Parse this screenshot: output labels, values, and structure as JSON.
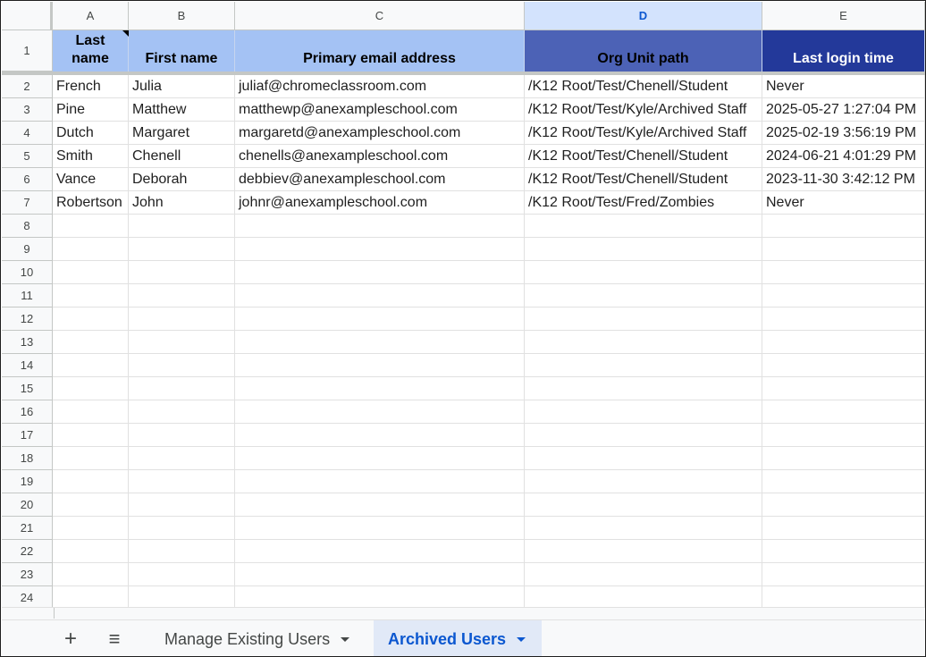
{
  "columns": [
    "A",
    "B",
    "C",
    "D",
    "E"
  ],
  "selected_column": "D",
  "rows": [
    "1",
    "2",
    "3",
    "4",
    "5",
    "6",
    "7",
    "8",
    "9",
    "10",
    "11",
    "12",
    "13",
    "14",
    "15",
    "16",
    "17",
    "18",
    "19",
    "20",
    "21",
    "22",
    "23",
    "24"
  ],
  "header_cells": [
    {
      "text": "Last\nname",
      "bg": "#a4c2f4",
      "fg": "#000000"
    },
    {
      "text": "First name",
      "bg": "#a4c2f4",
      "fg": "#000000"
    },
    {
      "text": "Primary email address",
      "bg": "#a4c2f4",
      "fg": "#000000"
    },
    {
      "text": "Org Unit path",
      "bg": "#4c62b6",
      "fg": "#000000"
    },
    {
      "text": "Last login time",
      "bg": "#23399a",
      "fg": "#ffffff"
    }
  ],
  "data": [
    [
      "French",
      "Julia",
      "juliaf@chromeclassroom.com",
      "/K12 Root/Test/Chenell/Student",
      "Never"
    ],
    [
      "Pine",
      "Matthew",
      "matthewp@anexampleschool.com",
      "/K12 Root/Test/Kyle/Archived Staff",
      "2025-05-27 1:27:04 PM"
    ],
    [
      "Dutch",
      "Margaret",
      "margaretd@anexampleschool.com",
      "/K12 Root/Test/Kyle/Archived Staff",
      "2025-02-19 3:56:19 PM"
    ],
    [
      "Smith",
      "Chenell",
      "chenells@anexampleschool.com",
      "/K12 Root/Test/Chenell/Student",
      "2024-06-21 4:01:29 PM"
    ],
    [
      "Vance",
      "Deborah",
      "debbiev@anexampleschool.com",
      "/K12 Root/Test/Chenell/Student",
      "2023-11-30 3:42:12 PM"
    ],
    [
      "Robertson",
      "John",
      "johnr@anexampleschool.com",
      "/K12 Root/Test/Fred/Zombies",
      "Never"
    ]
  ],
  "tabbar": {
    "add_icon": "plus-icon",
    "all_sheets_icon": "hamburger-menu-icon",
    "tabs": [
      {
        "label": "Manage Existing Users",
        "active": false
      },
      {
        "label": "Archived Users",
        "active": true
      }
    ]
  },
  "colors": {
    "accent": "#0b57d0",
    "selected_col_bg": "#d3e3fd"
  }
}
